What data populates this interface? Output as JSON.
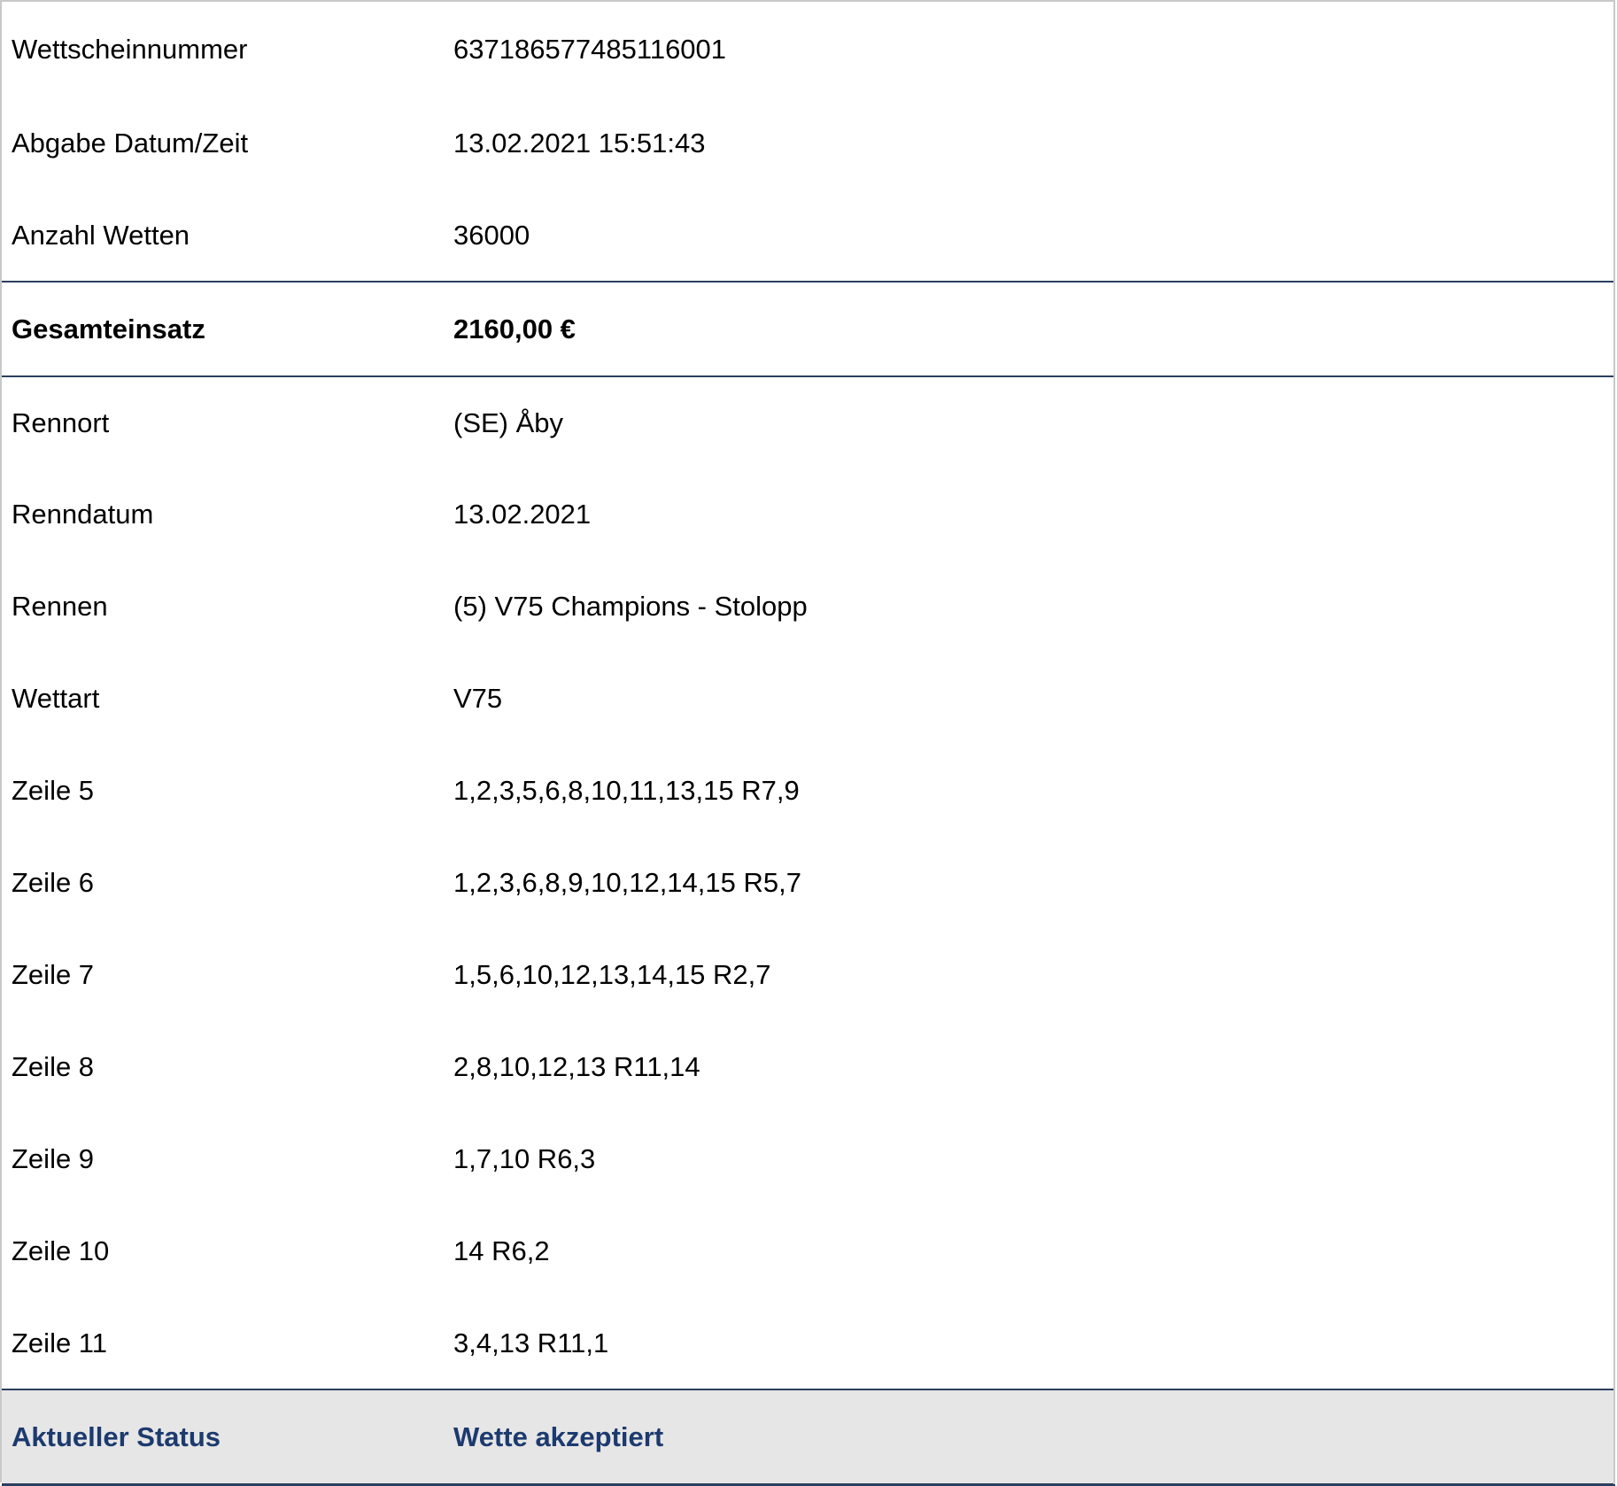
{
  "ticket": {
    "rows_top": [
      {
        "label": "Wettscheinnummer",
        "value": "637186577485116001"
      },
      {
        "label": "Abgabe Datum/Zeit",
        "value": "13.02.2021 15:51:43"
      },
      {
        "label": "Anzahl Wetten",
        "value": "36000"
      }
    ],
    "total": {
      "label": "Gesamteinsatz",
      "value": "2160,00 €"
    },
    "rows_race": [
      {
        "label": "Rennort",
        "value": "(SE) Åby"
      },
      {
        "label": "Renndatum",
        "value": "13.02.2021"
      },
      {
        "label": "Rennen",
        "value": "(5) V75 Champions - Stolopp"
      },
      {
        "label": "Wettart",
        "value": "V75"
      },
      {
        "label": "Zeile 5",
        "value": "1,2,3,5,6,8,10,11,13,15 R7,9"
      },
      {
        "label": "Zeile 6",
        "value": "1,2,3,6,8,9,10,12,14,15 R5,7"
      },
      {
        "label": "Zeile 7",
        "value": "1,5,6,10,12,13,14,15 R2,7"
      },
      {
        "label": "Zeile 8",
        "value": "2,8,10,12,13 R11,14"
      },
      {
        "label": "Zeile 9",
        "value": "1,7,10 R6,3"
      },
      {
        "label": "Zeile 10",
        "value": "14 R6,2"
      },
      {
        "label": "Zeile 11",
        "value": "3,4,13 R11,1"
      }
    ],
    "status": {
      "label": "Aktueller Status",
      "value": "Wette akzeptiert"
    }
  },
  "colors": {
    "border_dark": "#2a3f5f",
    "status_text": "#1c3a6e",
    "status_background": "#e6e6e6"
  }
}
